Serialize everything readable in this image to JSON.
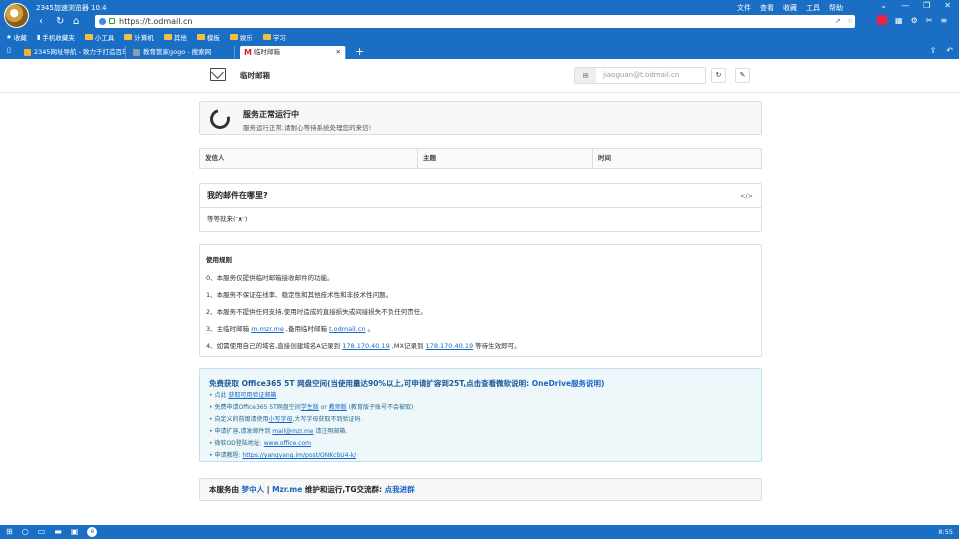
{
  "browser": {
    "title": "2345加速浏览器 10.4",
    "menu": [
      "文件",
      "查看",
      "收藏",
      "工具",
      "帮助"
    ],
    "window_controls": [
      "⌄",
      "—",
      "❐",
      "✕"
    ],
    "address": "https://t.odmail.cn",
    "bookmarks": [
      "收藏",
      "手机收藏夹",
      "小工具",
      "计算机",
      "其他",
      "模板",
      "娱乐",
      "学习"
    ],
    "tabs": [
      {
        "title": "2345网址导航 - 致力于打造百年品牌",
        "active": false
      },
      {
        "title": "教育管家gogo - 搜索网",
        "active": false
      },
      {
        "title": "临时邮箱",
        "active": true
      }
    ],
    "new_tab": "+"
  },
  "site": {
    "title": "临时邮箱",
    "email": "jiaoguan@t.odmail.cn"
  },
  "status": {
    "title": "服务正常运行中",
    "desc": "服务运行正常,请耐心等待系统处理您的来信!"
  },
  "mail_columns": [
    "发信人",
    "主题",
    "时间"
  ],
  "where": {
    "title": "我的邮件在哪里?",
    "code_icon": "</>",
    "body": "等等就来(ᵔᴥᵔ)"
  },
  "rules": {
    "title": "使用规则",
    "r0": "0、本服务仅提供临时邮箱接收邮件的功能。",
    "r1": "1、本服务不保证在线率、稳定性和其他技术性和非技术性问题。",
    "r2": "2、本服务不提供任何支持,使用时造成的直接损失或间接损失不负任何责任。",
    "r3_a": "3、主临时邮箱 ",
    "r3_link1": "m.mzr.me",
    "r3_b": " ,备用临时邮箱 ",
    "r3_link2": "t.odmail.cn",
    "r3_c": " 。",
    "r4_a": "4、如需使用自己的域名,直接创建域名A记录到 ",
    "r4_ip1": "178.170.40.19",
    "r4_b": " ,MX记录到 ",
    "r4_ip2": "178.170.40.19",
    "r4_c": " 等待生效即可。"
  },
  "o365": {
    "title_a": "免费获取 Office365 5T 网盘空间(当使用量达90%以上,可申请扩容到25T,点击查看微软说明: ",
    "title_link": "OneDrive服务说明",
    "title_b": ")",
    "i1_a": "点此 ",
    "i1_link": "获取可用验证邮箱",
    "i2_a": "免费申请Office365 5T网盘空间",
    "i2_link1": "学生版",
    "i2_b": " or ",
    "i2_link2": "教师版",
    "i2_c": " (教育版子账号不会被取)",
    "i3_a": "自定义的前缀请使用",
    "i3_link": "小写字母",
    "i3_b": ",大写字母获取不到验证码.",
    "i4_a": "申请扩容,请发邮件到 ",
    "i4_link": "mail@mzr.me",
    "i4_b": " 请注明邮箱.",
    "i5_a": "微软OD登陆地址: ",
    "i5_link": "www.office.com",
    "i6_a": "申请教程: ",
    "i6_link": "https://yangyang.im/post/ONKcbU4-k/"
  },
  "footer": {
    "a": "本服务由 ",
    "link1": "梦中人",
    "sep": " | ",
    "link2": "Mzr.me",
    "b": " 维护和运行,TG交流群: ",
    "link3": "点我进群"
  },
  "taskbar": {
    "clock": "8:55"
  }
}
